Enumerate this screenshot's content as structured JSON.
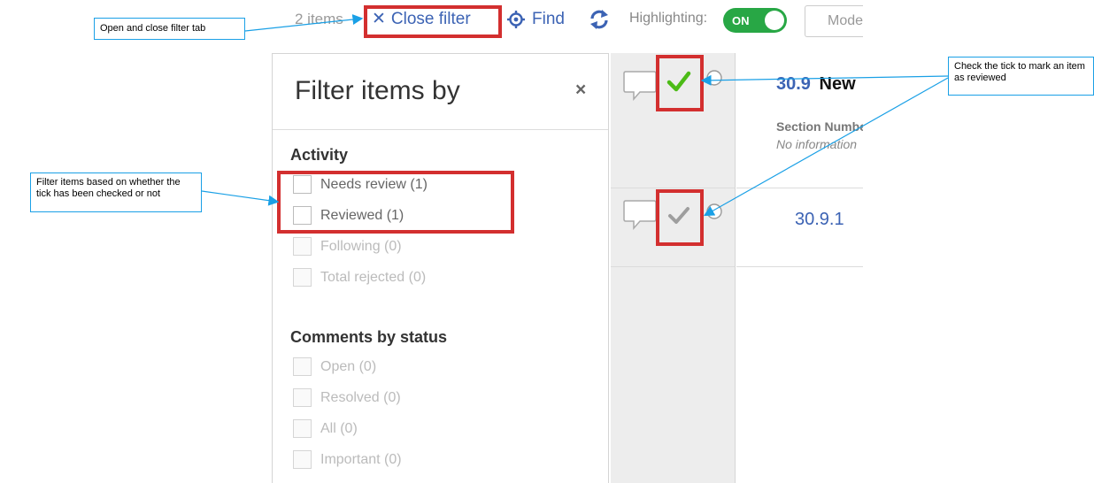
{
  "toolbar": {
    "items_count": "2 items",
    "close_filter_label": "Close filter",
    "find_label": "Find",
    "highlighting_label": "Highlighting:",
    "highlighting_state": "ON",
    "mode_label": "Mode"
  },
  "filter_panel": {
    "title": "Filter items by",
    "close_symbol": "×",
    "sections": [
      {
        "title": "Activity",
        "options": [
          {
            "label": "Needs review (1)",
            "enabled": true
          },
          {
            "label": "Reviewed (1)",
            "enabled": true
          },
          {
            "label": "Following (0)",
            "enabled": false
          },
          {
            "label": "Total rejected (0)",
            "enabled": false
          }
        ]
      },
      {
        "title": "Comments by status",
        "options": [
          {
            "label": "Open (0)",
            "enabled": false
          },
          {
            "label": "Resolved (0)",
            "enabled": false
          },
          {
            "label": "All (0)",
            "enabled": false
          },
          {
            "label": "Important (0)",
            "enabled": false
          }
        ]
      }
    ]
  },
  "items": [
    {
      "number": "30.9",
      "name": "New",
      "field_label": "Section Number",
      "field_value": "No information",
      "reviewed": true
    },
    {
      "number": "30.9.1",
      "reviewed": false
    }
  ],
  "callouts": {
    "close_filter": "Open and close filter tab",
    "filter_items": "Filter items based on whether the tick has been checked or not",
    "tick": "Check the tick to mark an item as reviewed"
  },
  "colors": {
    "accent_blue": "#3c63b4",
    "toggle_green": "#28a745",
    "tick_green": "#4cbb17",
    "tick_grey": "#9e9e9e",
    "highlight_red": "#d32f2f",
    "callout_blue": "#1aa0e6"
  }
}
